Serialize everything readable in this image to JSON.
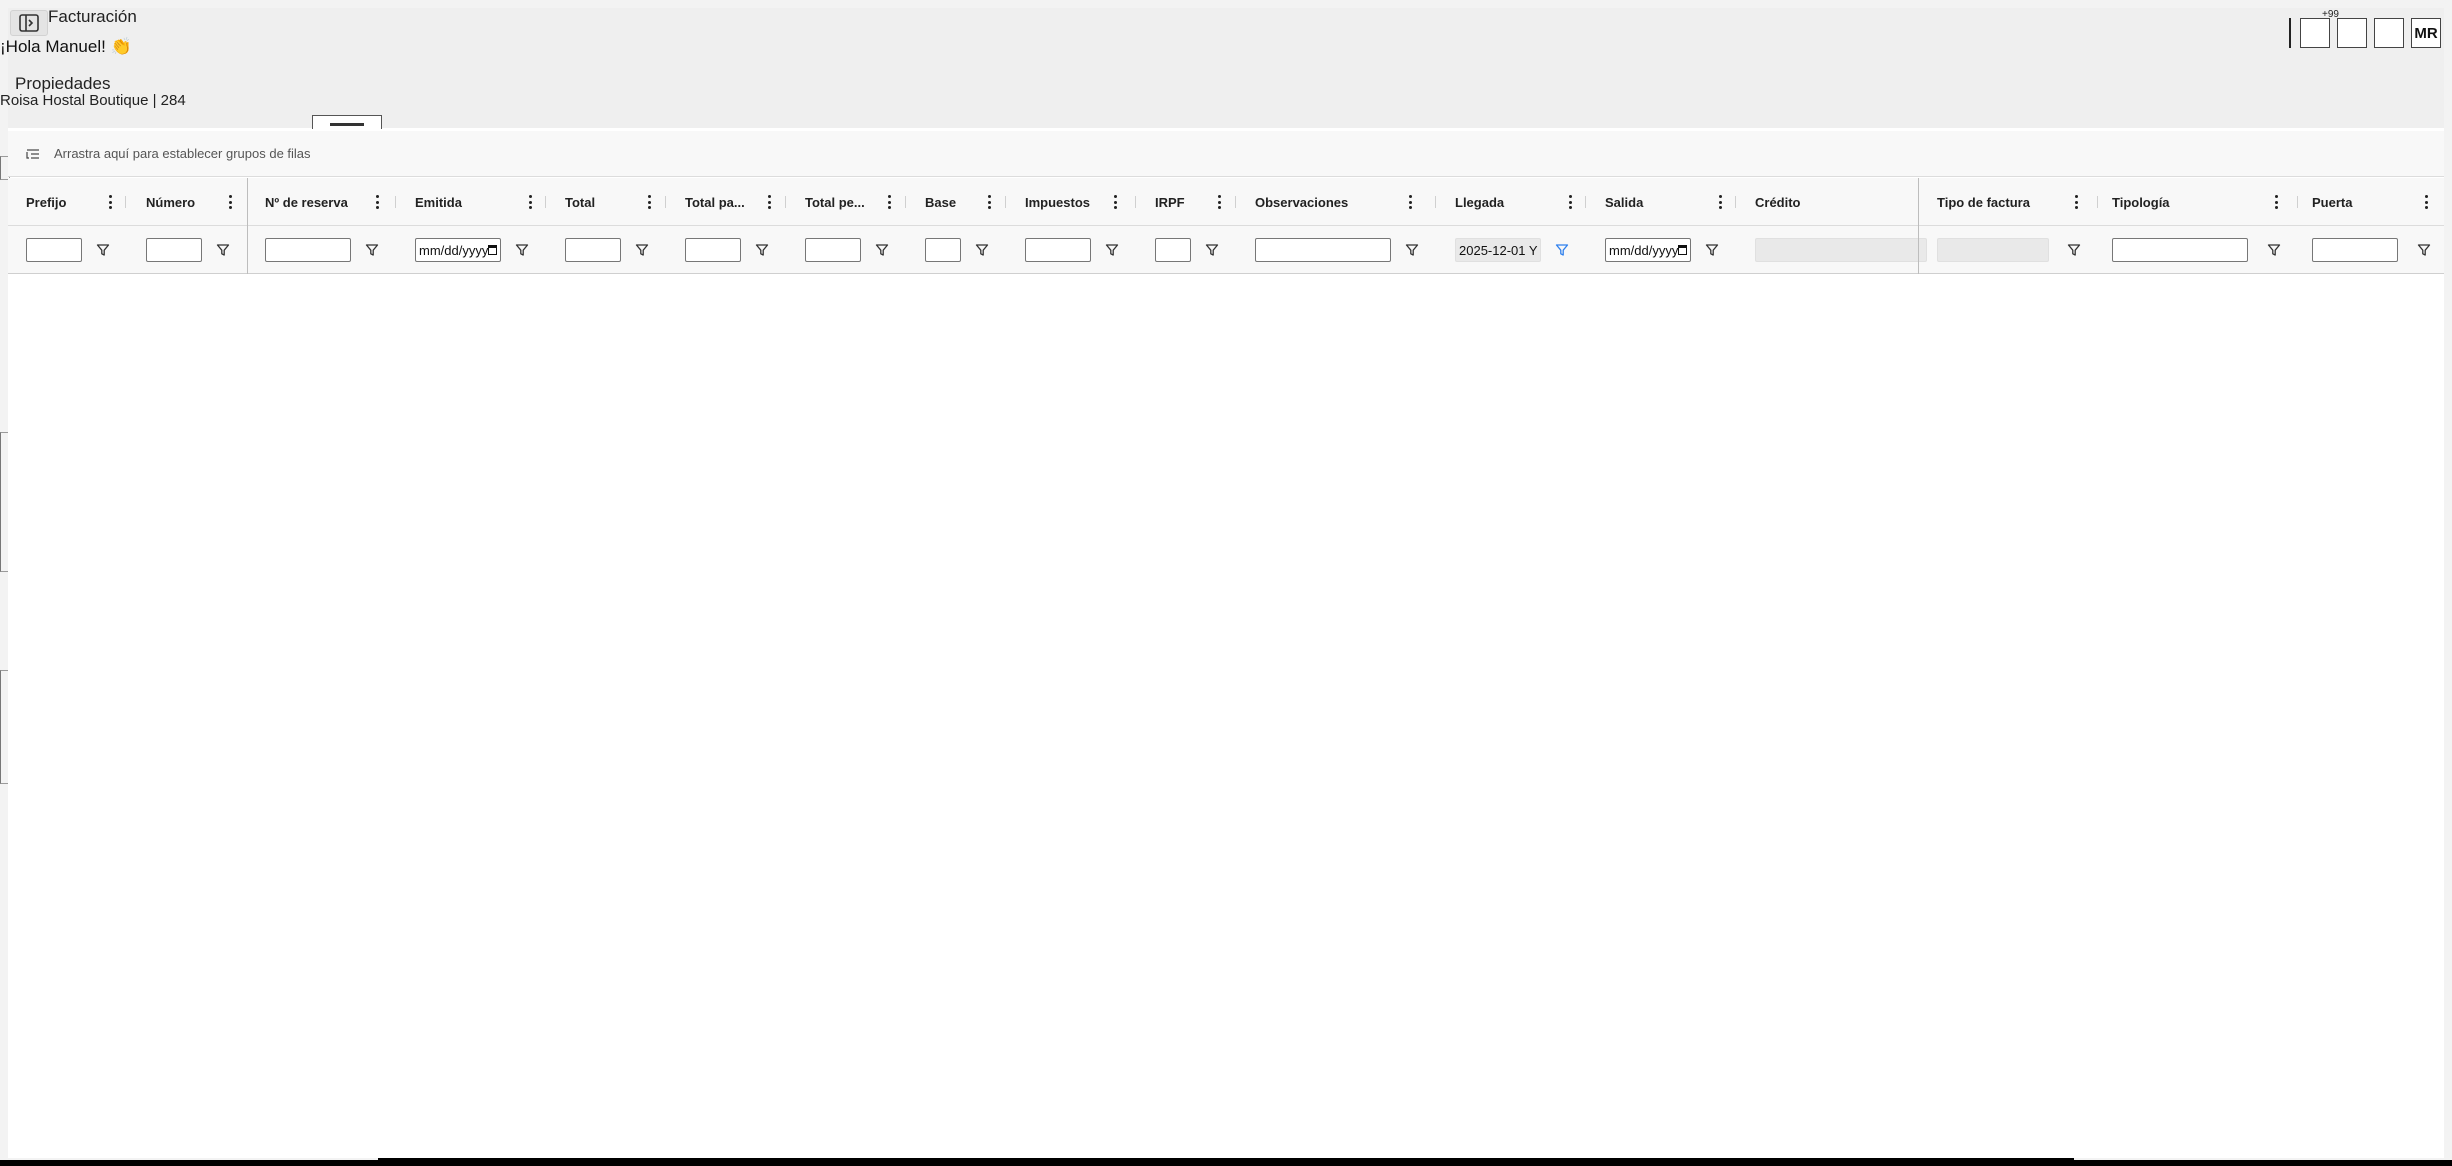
{
  "app": {
    "title": "Facturación",
    "greeting": "¡Hola Manuel! 👏",
    "section_title": "Propiedades",
    "property_line": "Roisa Hostal Boutique | 284"
  },
  "header": {
    "badge": "+99",
    "avatar_initials": "MR"
  },
  "grid": {
    "group_panel_text": "Arrastra aquí para establecer grupos de filas",
    "columns": [
      {
        "label": "Prefijo",
        "filter_type": "text",
        "filter_value": ""
      },
      {
        "label": "Número",
        "filter_type": "text",
        "filter_value": ""
      },
      {
        "label": "Nº de reserva",
        "filter_type": "text",
        "filter_value": ""
      },
      {
        "label": "Emitida",
        "filter_type": "date",
        "filter_value": "mm/dd/yyyy"
      },
      {
        "label": "Total",
        "filter_type": "text",
        "filter_value": ""
      },
      {
        "label": "Total pa...",
        "filter_type": "text",
        "filter_value": ""
      },
      {
        "label": "Total pe...",
        "filter_type": "text",
        "filter_value": ""
      },
      {
        "label": "Base",
        "filter_type": "text",
        "filter_value": ""
      },
      {
        "label": "Impuestos",
        "filter_type": "text",
        "filter_value": ""
      },
      {
        "label": "IRPF",
        "filter_type": "text",
        "filter_value": ""
      },
      {
        "label": "Observaciones",
        "filter_type": "text",
        "filter_value": ""
      },
      {
        "label": "Llegada",
        "filter_type": "readonly",
        "filter_value": "2025-12-01 Y"
      },
      {
        "label": "Salida",
        "filter_type": "date",
        "filter_value": "mm/dd/yyyy"
      },
      {
        "label": "Crédito",
        "filter_type": "disabled",
        "filter_value": ""
      },
      {
        "label": "Tipo de factura",
        "filter_type": "disabled",
        "filter_value": ""
      },
      {
        "label": "Tipología",
        "filter_type": "text",
        "filter_value": ""
      },
      {
        "label": "Puerta",
        "filter_type": "text",
        "filter_value": ""
      }
    ]
  },
  "colors": {
    "accent_filter_active": "#2f80ed",
    "header_bg": "#f8f8f8",
    "backdrop": "#f3f3f3"
  }
}
